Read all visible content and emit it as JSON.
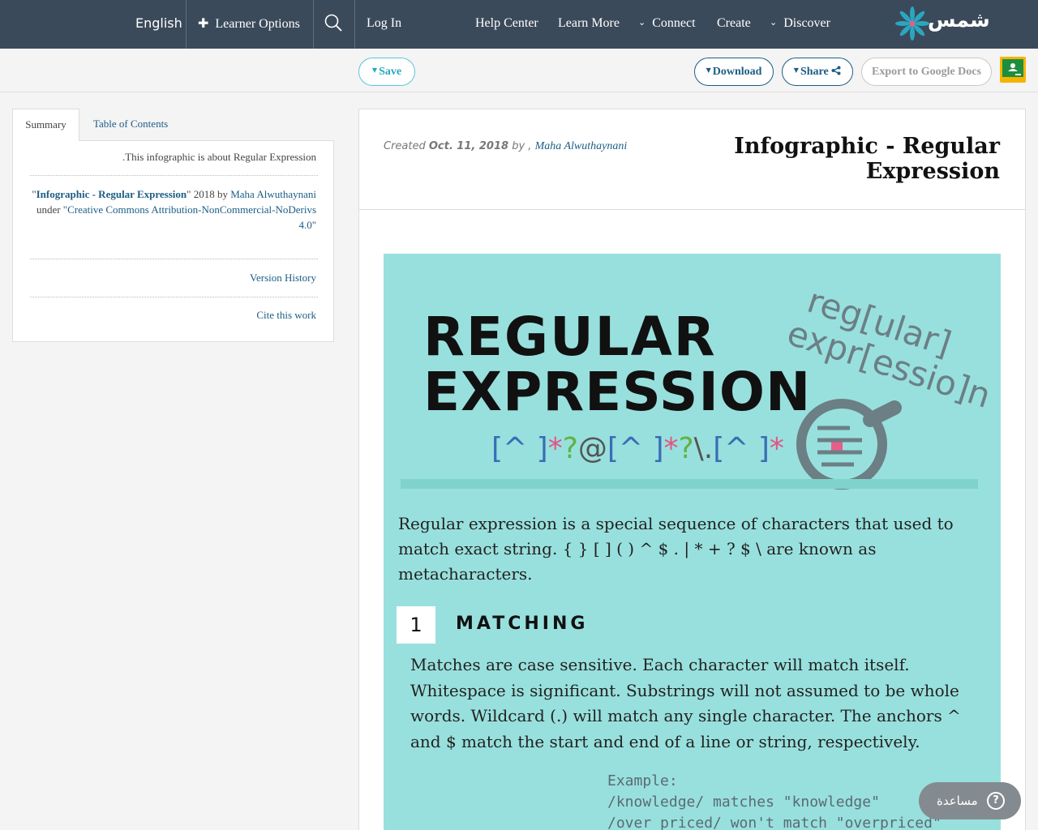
{
  "nav": {
    "language": "English",
    "learner_options": "Learner Options",
    "log_in": "Log In",
    "help_center": "Help Center",
    "learn_more": "Learn More",
    "connect": "Connect",
    "create": "Create",
    "discover": "Discover",
    "logo_text": "شمس"
  },
  "toolbar": {
    "save": "Save",
    "download": "Download",
    "share": "Share",
    "export": "Export to Google Docs"
  },
  "sidebar": {
    "tabs": [
      "Summary",
      "Table of Contents"
    ],
    "summary_text": ".This infographic is about Regular Expression",
    "attribution": {
      "quote_open": "\"",
      "title": "Infographic - Regular Expression",
      "quote_mid": "\" 2018 by ",
      "author": "Maha Alwuthaynani",
      "under": "under ",
      "license": "\"Creative Commons Attribution-NonCommercial-NoDerivs 4.0",
      "quote_close": "\""
    },
    "version_history": "Version History",
    "cite": "Cite this work"
  },
  "main": {
    "created_label": "Created",
    "date": "Oct. 11, 2018",
    "by": "by ,",
    "author": "Maha Alwuthaynani",
    "title": "Infographic - Regular Expression"
  },
  "infographic": {
    "heading_1": "REGULAR",
    "heading_2": "EXPRESSION",
    "regex_parts": [
      "[^ ]",
      "*",
      "?",
      "@",
      "[^ ]",
      "*",
      "?",
      "\\.",
      "[^ ]",
      "*"
    ],
    "deco_1": "reg[ular]",
    "deco_2": "expr[essio]n",
    "intro": "Regular expression is a special sequence of characters that used to match exact string.  { } [ ] ( ) ^ $ . | * + ? $ \\ are known as metacharacters.",
    "section_number": "1",
    "section_title": "MATCHING",
    "section_text": "Matches are case sensitive. Each character will match itself. Whitespace is significant. Substrings will not assumed to be whole words. Wildcard (.) will match any single character.  The anchors ^ and $ match the start and end of a line or string, respectively.",
    "example_label": "Example:",
    "example_1": "/knowledge/ matches \"knowledge\"",
    "example_2": "/over priced/ won't match \"overpriced\""
  },
  "help": {
    "label": "مساعدة",
    "icon": "?"
  },
  "colors": {
    "nav_bg": "#3b4a5a",
    "link": "#1c5d84",
    "infographic_bg": "#98e0dd",
    "save_accent": "#2aa7c0"
  }
}
